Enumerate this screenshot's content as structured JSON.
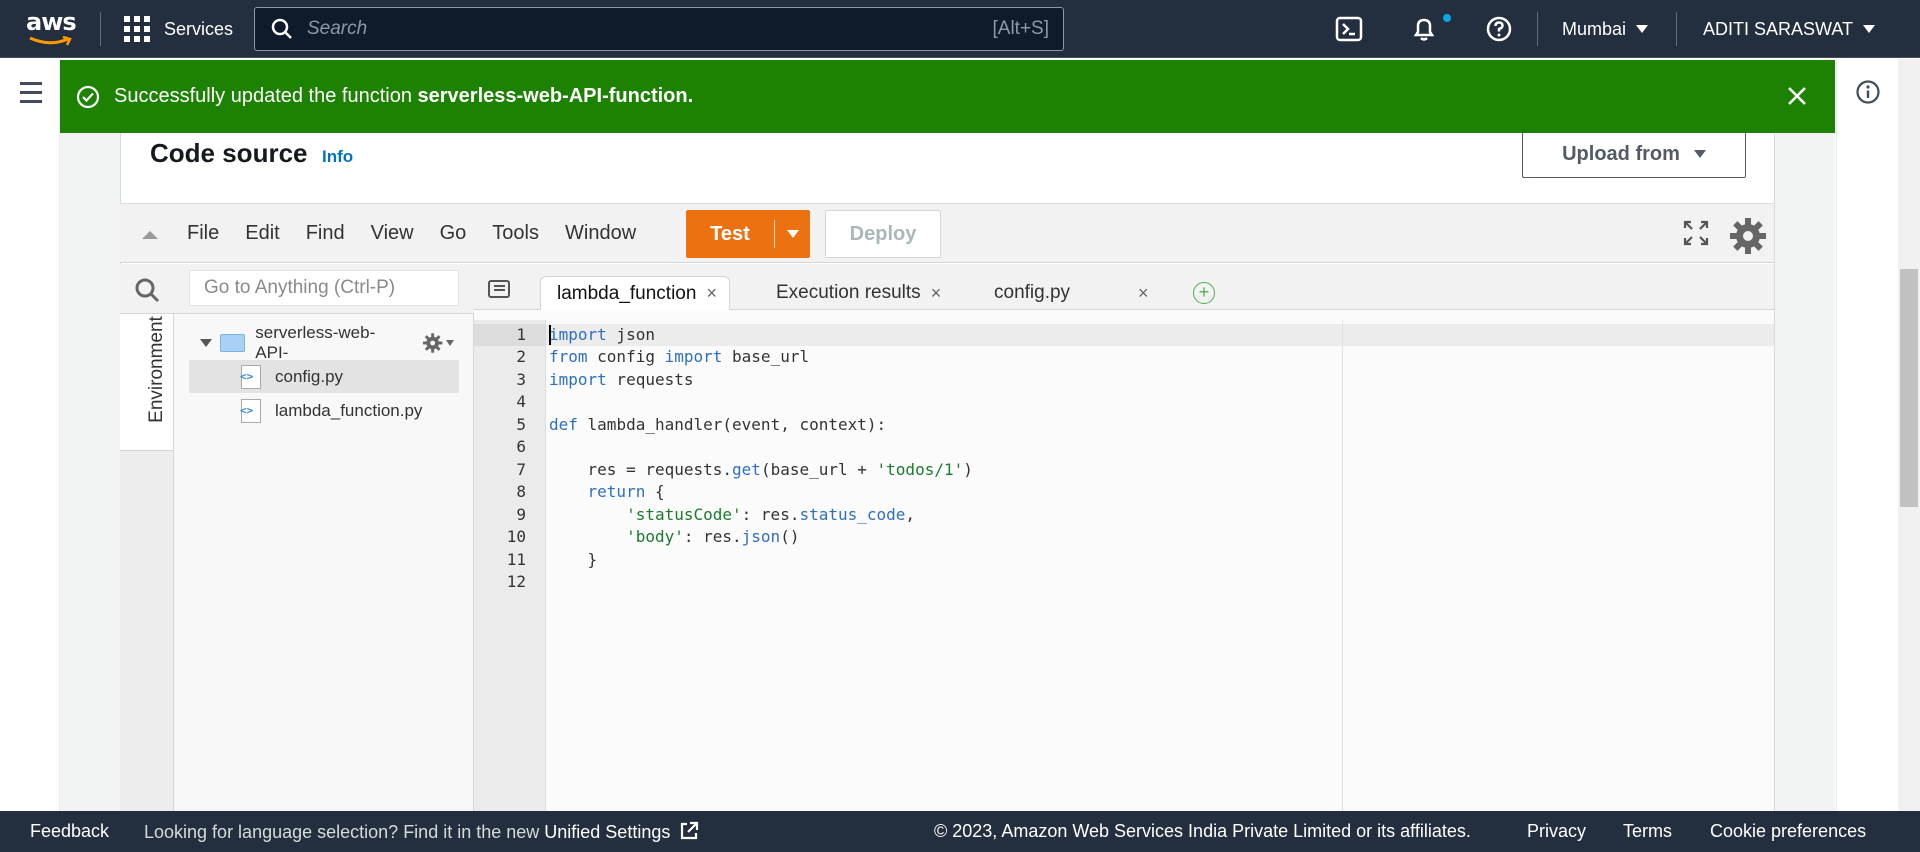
{
  "topbar": {
    "logo_text": "aws",
    "services_label": "Services",
    "search_placeholder": "Search",
    "search_shortcut": "[Alt+S]",
    "region": "Mumbai",
    "user": "ADITI SARASWAT"
  },
  "flash": {
    "message_prefix": "Successfully updated the function ",
    "function_name": "serverless-web-API-function",
    "message_suffix": ".",
    "color": "#1d8102"
  },
  "panel": {
    "title": "Code source",
    "info_link": "Info",
    "upload_label": "Upload from"
  },
  "ide": {
    "menu": [
      "File",
      "Edit",
      "Find",
      "View",
      "Go",
      "Tools",
      "Window"
    ],
    "test_label": "Test",
    "deploy_label": "Deploy",
    "goto_placeholder": "Go to Anything (Ctrl-P)",
    "environment_label": "Environment",
    "tree": {
      "folder": "serverless-web-API-",
      "files": [
        "config.py",
        "lambda_function.py"
      ]
    },
    "tabs": [
      {
        "label": "lambda_function",
        "close": "×"
      },
      {
        "label": "Execution results",
        "close": "×"
      },
      {
        "label": "config.py",
        "close": "×"
      }
    ],
    "code_lines": [
      "1",
      "2",
      "3",
      "4",
      "5",
      "6",
      "7",
      "8",
      "9",
      "10",
      "11",
      "12"
    ],
    "accent": "#ec7211"
  },
  "footer": {
    "feedback": "Feedback",
    "language_prompt": "Looking for language selection? Find it in the new ",
    "unified_settings": "Unified Settings",
    "copyright": "© 2023, Amazon Web Services India Private Limited or its affiliates.",
    "privacy": "Privacy",
    "terms": "Terms",
    "cookie": "Cookie preferences"
  }
}
